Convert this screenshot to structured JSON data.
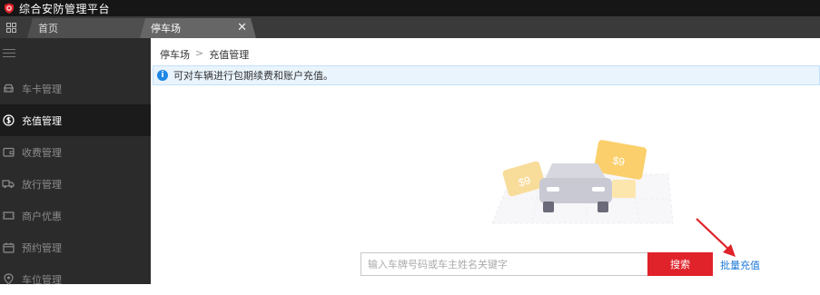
{
  "app": {
    "title": "综合安防管理平台"
  },
  "tabs": [
    {
      "label": "首页"
    },
    {
      "label": "停车场",
      "close": "✕"
    }
  ],
  "sidebar": {
    "items": [
      {
        "label": "车卡管理",
        "icon": "car-icon"
      },
      {
        "label": "充值管理",
        "icon": "dollar-icon",
        "active": true
      },
      {
        "label": "收费管理",
        "icon": "wallet-icon"
      },
      {
        "label": "放行管理",
        "icon": "truck-icon"
      },
      {
        "label": "商户优惠",
        "icon": "ticket-icon"
      },
      {
        "label": "预约管理",
        "icon": "calendar-icon"
      },
      {
        "label": "车位管理",
        "icon": "location-icon"
      }
    ]
  },
  "breadcrumb": {
    "root": "停车场",
    "separator": ">",
    "current": "充值管理"
  },
  "info": {
    "icon": "i",
    "text": "可对车辆进行包期续费和账户充值。"
  },
  "illustration": {
    "coin_left": "$9",
    "coin_right": "$9"
  },
  "search": {
    "placeholder": "输入车牌号码或车主姓名关键字",
    "value": "",
    "button_label": "搜索"
  },
  "batch_recharge": {
    "label": "批量充值"
  },
  "colors": {
    "accent_red": "#e0222a",
    "link_blue": "#1e78d7",
    "info_blue": "#1e88e5"
  }
}
